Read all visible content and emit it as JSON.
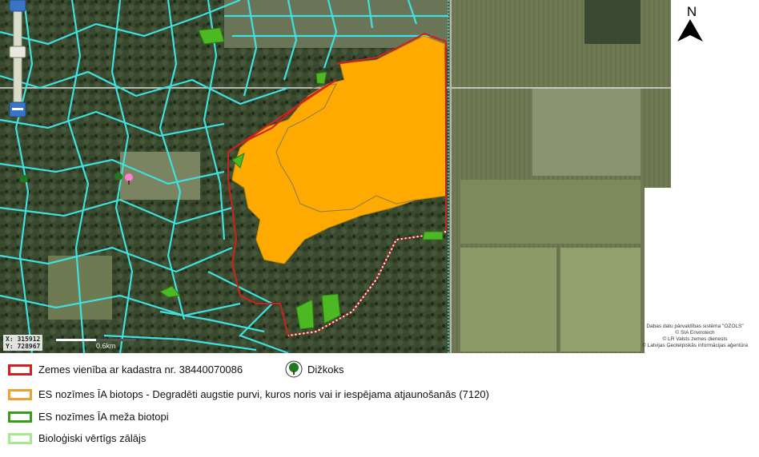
{
  "map": {
    "north_label": "N",
    "coordinates": {
      "x": "X: 315912",
      "y": "Y: 728967"
    },
    "scale_label": "0.6km",
    "credits": [
      "Dabas datu pārvaldības sistēma \"OZOLS\"",
      "© SIA Envirotech",
      "© LR Valsts zemes dienests",
      "© Latvijas Ģeotelpiskās informācijas aģentūra"
    ]
  },
  "legend": {
    "parcel": {
      "label": "Zemes vienība ar kadastra nr. 38440070086",
      "color": "#d02020"
    },
    "big_tree": {
      "label": "Dižkoks",
      "color": "#1e7a1e"
    },
    "bog_habitat": {
      "label": "ES nozīmes ĪA biotops - Degradēti augstie purvi, kuros noris vai ir iespējama atjaunošanās (7120)",
      "color": "#f0a030"
    },
    "forest_habitat": {
      "label": "ES nozīmes ĪA meža biotopi",
      "color": "#3a9a1a"
    },
    "grassland": {
      "label": "Bioloģiski vērtīgs zālājs",
      "color": "#a8e890"
    }
  },
  "colors": {
    "cadastre_lines": "#40e0e0",
    "bog_fill": "#ffaa00",
    "forest_habitat_fill": "#4cb824"
  }
}
